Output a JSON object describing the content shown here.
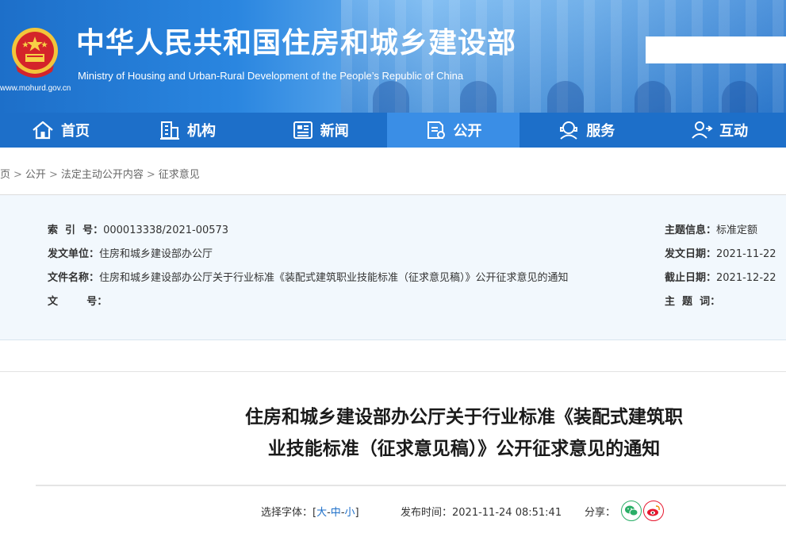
{
  "header": {
    "title": "中华人民共和国住房和城乡建设部",
    "subtitle": "Ministry of Housing and Urban-Rural Development of the People’s Republic of China",
    "url": "www.mohurd.gov.cn",
    "search_value": ""
  },
  "nav": {
    "items": [
      {
        "label": "首页",
        "icon": "home-icon"
      },
      {
        "label": "机构",
        "icon": "building-icon"
      },
      {
        "label": "新闻",
        "icon": "news-icon"
      },
      {
        "label": "公开",
        "icon": "document-icon"
      },
      {
        "label": "服务",
        "icon": "service-icon"
      },
      {
        "label": "互动",
        "icon": "interact-icon"
      }
    ],
    "active_index": 3
  },
  "breadcrumb": {
    "items": [
      "页",
      "公开",
      "法定主动公开内容",
      "征求意见"
    ],
    "separator": ">"
  },
  "info": {
    "index_label": "索  引  号：",
    "index_value": "000013338/2021-00573",
    "issuer_label": "发文单位：",
    "issuer_value": "住房和城乡建设部办公厅",
    "filename_label": "文件名称：",
    "filename_value": "住房和城乡建设部办公厅关于行业标准《装配式建筑职业技能标准（征求意见稿）》公开征求意见的通知",
    "docno_label": "文        号：",
    "docno_value": "",
    "topic_label": "主题信息：",
    "topic_value": "标准定额",
    "date_label": "发文日期：",
    "date_value": "2021-11-22",
    "deadline_label": "截止日期：",
    "deadline_value": "2021-12-22",
    "keywords_label": "主  题  词：",
    "keywords_value": ""
  },
  "article": {
    "title_line1": "住房和城乡建设部办公厅关于行业标准《装配式建筑职",
    "title_line2": "业技能标准（征求意见稿）》公开征求意见的通知"
  },
  "meta": {
    "font_label": "选择字体：[",
    "font_large": "大",
    "font_medium": "中",
    "font_small": "小",
    "font_dash": "-",
    "font_close": "]",
    "publish_label": "发布时间：",
    "publish_time": "2021-11-24 08:51:41",
    "share_label": "分享："
  },
  "colors": {
    "nav_bg": "#1d6fc9",
    "nav_active": "#3a8ee6",
    "panel_bg": "#f2f8fd",
    "wechat": "#2aae67",
    "weibo": "#e6162d"
  }
}
